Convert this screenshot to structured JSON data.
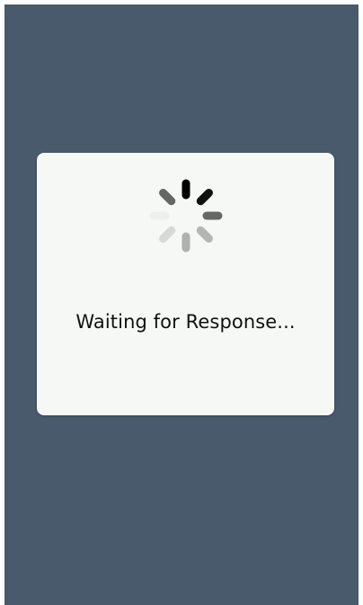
{
  "dialog": {
    "message": "Waiting for Response..."
  },
  "colors": {
    "backdrop": "#4a5a6d",
    "dialog_background": "#f5f8f5",
    "text": "#111111"
  },
  "spinner": {
    "icon": "loading-spinner-icon",
    "spoke_colors": [
      "#000000",
      "#111111",
      "#666666",
      "#b5b5b5",
      "#b0b0b0",
      "#d8d8d8",
      "#efeeee",
      "#666666"
    ]
  }
}
